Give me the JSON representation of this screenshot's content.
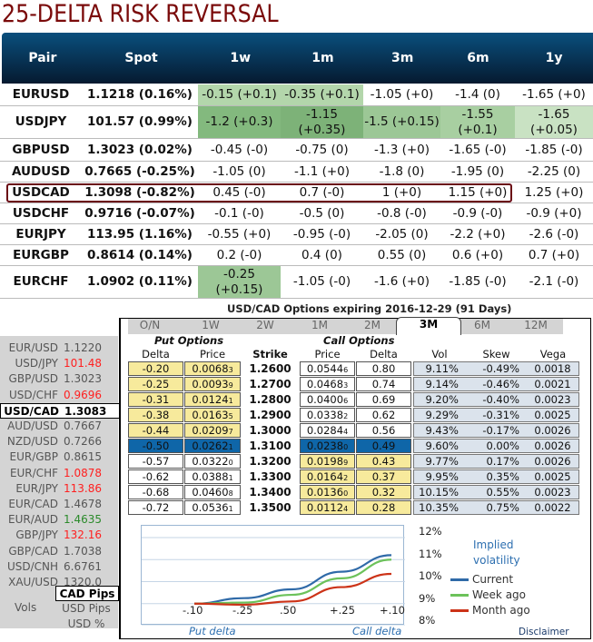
{
  "title": "25-DELTA RISK REVERSAL",
  "rr": {
    "headers": [
      "Pair",
      "Spot",
      "1w",
      "1m",
      "3m",
      "6m",
      "1y"
    ],
    "rows": [
      {
        "pair": "EURUSD",
        "spot": "1.1218 (0.16%)",
        "vals": [
          "-0.15 (+0.1)",
          "-0.35 (+0.1)",
          "-1.05 (+0)",
          "-1.4 (0)",
          "-1.65 (+0)"
        ],
        "colors": [
          "#b3d6ab",
          "#b3d6ab",
          "",
          "",
          ""
        ]
      },
      {
        "pair": "USDJPY",
        "spot": "101.57 (0.99%)",
        "vals": [
          "-1.2 (+0.3)",
          "-1.15 (+0.35)",
          "-1.5 (+0.15)",
          "-1.55 (+0.1)",
          "-1.65 (+0.05)"
        ],
        "colors": [
          "#83b97e",
          "#7db278",
          "#9cc796",
          "#a8cfa1",
          "#c9e2c3"
        ]
      },
      {
        "pair": "GBPUSD",
        "spot": "1.3023 (0.02%)",
        "vals": [
          "-0.45 (-0)",
          "-0.75 (0)",
          "-1.3 (+0)",
          "-1.65 (-0)",
          "-1.85 (-0)"
        ],
        "colors": [
          "",
          "",
          "",
          "",
          ""
        ]
      },
      {
        "pair": "AUDUSD",
        "spot": "0.7665 (-0.25%)",
        "vals": [
          "-1.05 (0)",
          "-1.1 (+0)",
          "-1.8 (0)",
          "-1.95 (0)",
          "-2.25 (0)"
        ],
        "colors": [
          "",
          "",
          "",
          "",
          ""
        ]
      },
      {
        "pair": "USDCAD",
        "spot": "1.3098 (-0.82%)",
        "vals": [
          "0.45 (-0)",
          "0.7 (-0)",
          "1 (+0)",
          "1.15 (+0)",
          "1.25 (+0)"
        ],
        "colors": [
          "",
          "",
          "",
          "",
          ""
        ]
      },
      {
        "pair": "USDCHF",
        "spot": "0.9716 (-0.07%)",
        "vals": [
          "-0.1 (-0)",
          "-0.5 (0)",
          "-0.8 (-0)",
          "-0.9 (-0)",
          "-0.9 (+0)"
        ],
        "colors": [
          "",
          "",
          "",
          "",
          ""
        ]
      },
      {
        "pair": "EURJPY",
        "spot": "113.95 (1.16%)",
        "vals": [
          "-0.55 (+0)",
          "-0.95 (-0)",
          "-2.05 (0)",
          "-2.2 (+0)",
          "-2.6 (-0)"
        ],
        "colors": [
          "",
          "",
          "",
          "",
          ""
        ]
      },
      {
        "pair": "EURGBP",
        "spot": "0.8614 (0.14%)",
        "vals": [
          "0.2 (-0)",
          "0.4 (0)",
          "0.55 (0)",
          "0.6 (+0)",
          "0.7 (+0)"
        ],
        "colors": [
          "",
          "",
          "",
          "",
          ""
        ]
      },
      {
        "pair": "EURCHF",
        "spot": "1.0902 (0.11%)",
        "vals": [
          "-0.25 (+0.15)",
          "-1.05 (-0)",
          "-1.6 (+0)",
          "-1.85 (-0)",
          "-2.1 (-0)"
        ],
        "colors": [
          "#9cc796",
          "",
          "",
          "",
          ""
        ]
      }
    ]
  },
  "quotes": [
    {
      "pair": "EUR/USD",
      "price": "1.1220",
      "color": "#555555"
    },
    {
      "pair": "USD/JPY",
      "price": "101.48",
      "color": "#ff2020"
    },
    {
      "pair": "GBP/USD",
      "price": "1.3023",
      "color": "#555555"
    },
    {
      "pair": "USD/CHF",
      "price": "0.9696",
      "color": "#ff2020"
    },
    {
      "pair": "USD/CAD",
      "price": "1.3083",
      "color": "#000000",
      "selected": true
    },
    {
      "pair": "AUD/USD",
      "price": "0.7667",
      "color": "#555555"
    },
    {
      "pair": "NZD/USD",
      "price": "0.7266",
      "color": "#555555"
    },
    {
      "pair": "EUR/GBP",
      "price": "0.8615",
      "color": "#555555"
    },
    {
      "pair": "EUR/CHF",
      "price": "1.0878",
      "color": "#ff2020"
    },
    {
      "pair": "EUR/JPY",
      "price": "113.86",
      "color": "#ff2020"
    },
    {
      "pair": "EUR/CAD",
      "price": "1.4678",
      "color": "#555555"
    },
    {
      "pair": "EUR/AUD",
      "price": "1.4635",
      "color": "#2a8a2a"
    },
    {
      "pair": "GBP/JPY",
      "price": "132.16",
      "color": "#ff2020"
    },
    {
      "pair": "GBP/CAD",
      "price": "1.7038",
      "color": "#555555"
    },
    {
      "pair": "USD/CNH",
      "price": "6.6761",
      "color": "#555555"
    },
    {
      "pair": "XAU/USD",
      "price": "1320.0",
      "color": "#555555"
    }
  ],
  "units": {
    "label": "Vols",
    "options": [
      "CAD Pips",
      "USD Pips",
      "USD %"
    ],
    "selected": "CAD Pips"
  },
  "options": {
    "title": "USD/CAD Options expiring 2016-12-29 (91 Days)",
    "tabs": [
      "O/N",
      "1W",
      "2W",
      "1M",
      "2M",
      "3M",
      "6M",
      "12M"
    ],
    "active_tab": "3M",
    "put_header": "Put Options",
    "call_header": "Call Options",
    "col_headers": {
      "put_delta": "Delta",
      "put_price": "Price",
      "strike": "Strike",
      "call_price": "Price",
      "call_delta": "Delta",
      "vol": "Vol",
      "skew": "Skew",
      "vega": "Vega"
    },
    "rows": [
      {
        "put_delta": "-0.20",
        "put_price": "0.0068",
        "put_pip": "3",
        "strike": "1.2600",
        "call_price": "0.0544",
        "call_pip": "6",
        "call_delta": "0.80",
        "vol": "9.11%",
        "skew": "-0.49%",
        "vega": "0.0018"
      },
      {
        "put_delta": "-0.25",
        "put_price": "0.0093",
        "put_pip": "9",
        "strike": "1.2700",
        "call_price": "0.0468",
        "call_pip": "3",
        "call_delta": "0.74",
        "vol": "9.14%",
        "skew": "-0.46%",
        "vega": "0.0021"
      },
      {
        "put_delta": "-0.31",
        "put_price": "0.0124",
        "put_pip": "1",
        "strike": "1.2800",
        "call_price": "0.0400",
        "call_pip": "6",
        "call_delta": "0.69",
        "vol": "9.20%",
        "skew": "-0.40%",
        "vega": "0.0023"
      },
      {
        "put_delta": "-0.38",
        "put_price": "0.0163",
        "put_pip": "5",
        "strike": "1.2900",
        "call_price": "0.0338",
        "call_pip": "2",
        "call_delta": "0.62",
        "vol": "9.29%",
        "skew": "-0.31%",
        "vega": "0.0025"
      },
      {
        "put_delta": "-0.44",
        "put_price": "0.0209",
        "put_pip": "7",
        "strike": "1.3000",
        "call_price": "0.0284",
        "call_pip": "4",
        "call_delta": "0.56",
        "vol": "9.43%",
        "skew": "-0.17%",
        "vega": "0.0026"
      },
      {
        "put_delta": "-0.50",
        "put_price": "0.0262",
        "put_pip": "1",
        "strike": "1.3100",
        "call_price": "0.0238",
        "call_pip": "0",
        "call_delta": "0.49",
        "vol": "9.60%",
        "skew": "0.00%",
        "vega": "0.0026"
      },
      {
        "put_delta": "-0.57",
        "put_price": "0.0322",
        "put_pip": "0",
        "strike": "1.3200",
        "call_price": "0.0198",
        "call_pip": "9",
        "call_delta": "0.43",
        "vol": "9.77%",
        "skew": "0.17%",
        "vega": "0.0026"
      },
      {
        "put_delta": "-0.62",
        "put_price": "0.0388",
        "put_pip": "1",
        "strike": "1.3300",
        "call_price": "0.0164",
        "call_pip": "2",
        "call_delta": "0.37",
        "vol": "9.95%",
        "skew": "0.35%",
        "vega": "0.0025"
      },
      {
        "put_delta": "-0.68",
        "put_price": "0.0460",
        "put_pip": "8",
        "strike": "1.3400",
        "call_price": "0.0136",
        "call_pip": "0",
        "call_delta": "0.32",
        "vol": "10.15%",
        "skew": "0.55%",
        "vega": "0.0023"
      },
      {
        "put_delta": "-0.72",
        "put_price": "0.0536",
        "put_pip": "1",
        "strike": "1.3500",
        "call_price": "0.0112",
        "call_pip": "4",
        "call_delta": "0.28",
        "vol": "10.35%",
        "skew": "0.75%",
        "vega": "0.0022"
      }
    ],
    "atm_index": 5
  },
  "chart_data": {
    "type": "line",
    "title": "Implied volatility",
    "x": [
      "-.10",
      "-.25",
      ".50",
      "+.25",
      "+.10"
    ],
    "xlabel_left": "Put delta",
    "xlabel_right": "Call delta",
    "yticks": [
      "12%",
      "11%",
      "10%",
      "9%",
      "8%"
    ],
    "ylim": [
      8,
      12
    ],
    "series": [
      {
        "name": "Current",
        "color": "#2f6aa8",
        "values": [
          9.0,
          9.25,
          9.65,
          10.45,
          11.2
        ]
      },
      {
        "name": "Week ago",
        "color": "#6cc25a",
        "values": [
          9.0,
          9.05,
          9.4,
          10.15,
          11.0
        ]
      },
      {
        "name": "Month ago",
        "color": "#cc3318",
        "values": [
          9.0,
          8.95,
          9.1,
          9.75,
          10.35
        ]
      }
    ]
  },
  "disclaimer": "Disclaimer"
}
